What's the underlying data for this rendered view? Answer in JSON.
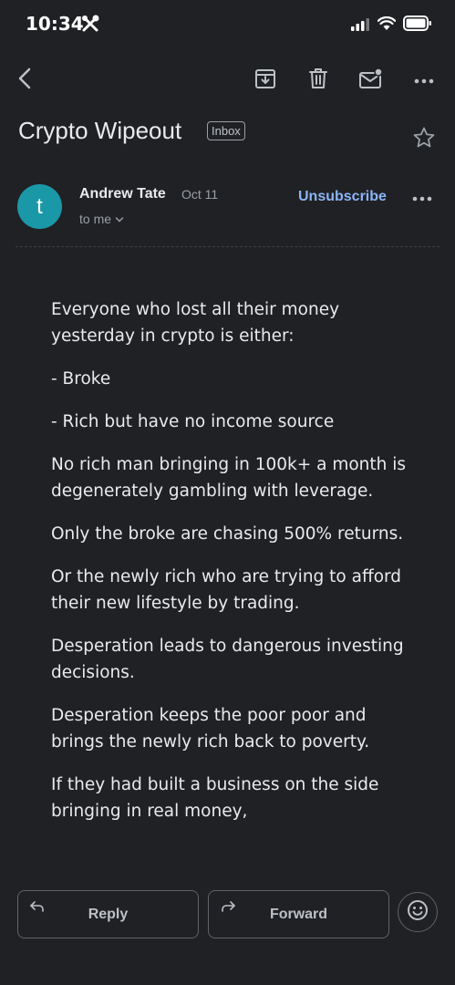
{
  "status": {
    "time": "10:34"
  },
  "email": {
    "subject": "Crypto Wipeout",
    "label": "Inbox",
    "sender": {
      "initial": "t",
      "name": "Andrew Tate",
      "date": "Oct 11",
      "recipient": "to me",
      "avatar_color": "#1a98a8"
    },
    "unsubscribe_label": "Unsubscribe",
    "body": [
      "Everyone who lost all their money yesterday in crypto is either:",
      "- Broke",
      "- Rich but have no income source",
      "No rich man bringing in 100k+ a month is degenerately gambling with leverage.",
      "Only the broke are chasing 500% returns.",
      "Or the newly rich who are trying to afford their new lifestyle by trading.",
      "Desperation leads to dangerous investing decisions.",
      "Desperation keeps the poor poor and brings the newly rich back to poverty.",
      "If they had built a business on the side bringing in real money,"
    ]
  },
  "actions": {
    "reply_label": "Reply",
    "forward_label": "Forward"
  },
  "icons": {
    "back": "back-arrow-icon",
    "archive": "archive-icon",
    "delete": "trash-icon",
    "mark_unread": "mark-unread-icon",
    "more": "more-horizontal-icon",
    "star": "star-outline-icon",
    "emoji": "emoji-reaction-icon"
  },
  "colors": {
    "background": "#202124",
    "accent": "#8ab4f8"
  }
}
